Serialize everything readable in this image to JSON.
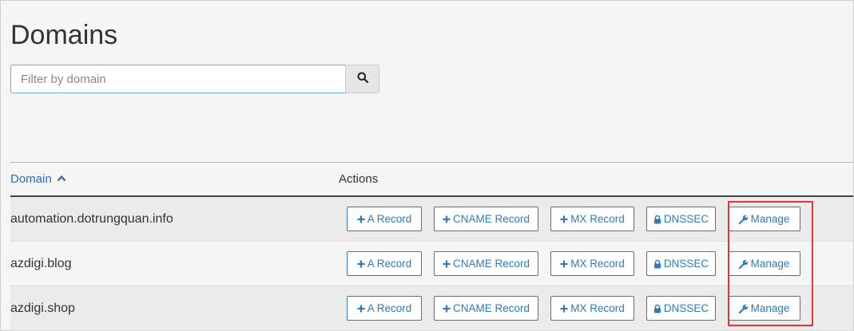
{
  "page": {
    "title": "Domains"
  },
  "search": {
    "placeholder": "Filter by domain",
    "value": "",
    "button_icon": "search-icon"
  },
  "table": {
    "columns": {
      "domain": "Domain",
      "actions": "Actions"
    },
    "sort_icon": "chevron-up-icon",
    "action_labels": {
      "a_record": "A Record",
      "cname_record": "CNAME Record",
      "mx_record": "MX Record",
      "dnssec": "DNSSEC",
      "manage": "Manage"
    },
    "rows": [
      {
        "domain": "automation.dotrungquan.info"
      },
      {
        "domain": "azdigi.blog"
      },
      {
        "domain": "azdigi.shop"
      }
    ]
  },
  "colors": {
    "link": "#337ab7",
    "highlight": "#e8333b",
    "input_focus": "#66afe9"
  }
}
